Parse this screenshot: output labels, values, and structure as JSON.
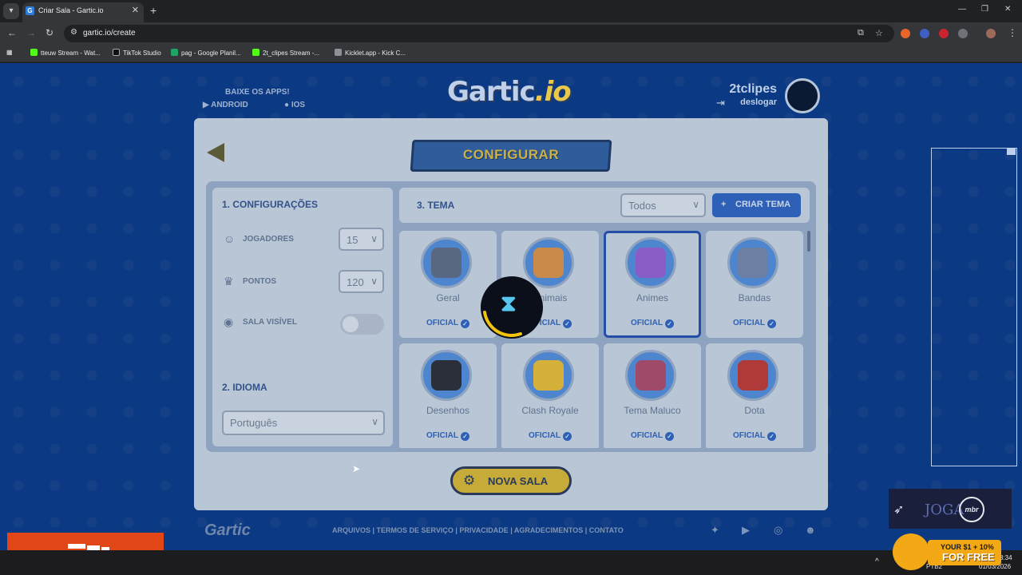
{
  "browser": {
    "tab_title": "Criar Sala - Gartic.io",
    "url": "gartic.io/create",
    "bookmarks": [
      {
        "label": "tteuw Stream - Wat...",
        "color": "#53fc18"
      },
      {
        "label": "TikTok Studio",
        "color": "#000000"
      },
      {
        "label": "pag - Google Planil...",
        "color": "#1fa463"
      },
      {
        "label": "2t_clipes Stream -...",
        "color": "#53fc18"
      },
      {
        "label": "Kicklet.app - Kick C...",
        "color": "#8e9097"
      }
    ]
  },
  "header": {
    "apps_title": "BAIXE OS APPS!",
    "android": "ANDROID",
    "ios": "IOS",
    "logo_main": "Gartic",
    "logo_suffix": ".io",
    "username": "2tclipes",
    "logout": "deslogar"
  },
  "config": {
    "banner": "CONFIGURAR",
    "settings_title": "1. CONFIGURAÇÕES",
    "players_label": "JOGADORES",
    "players_value": "15",
    "points_label": "PONTOS",
    "points_value": "120",
    "visible_label": "SALA VISÍVEL",
    "language_title": "2. IDIOMA",
    "language_value": "Português",
    "theme_title": "3. TEMA",
    "filter_value": "Todos",
    "create_theme": "CRIAR TEMA",
    "official_badge": "OFICIAL",
    "new_room": "NOVA SALA"
  },
  "themes": [
    {
      "label": "Geral",
      "icon": "slot-machine-icon",
      "selected": false,
      "color": "#5a6780"
    },
    {
      "label": "Animais",
      "icon": "dog-icon",
      "selected": false,
      "color": "#c98a4c"
    },
    {
      "label": "Animes",
      "icon": "anime-character-icon",
      "selected": true,
      "color": "#8a5cc7"
    },
    {
      "label": "Bandas",
      "icon": "microphone-icon",
      "selected": false,
      "color": "#6d7fa3"
    },
    {
      "label": "Desenhos",
      "icon": "mouse-cartoon-icon",
      "selected": false,
      "color": "#2b2f3a"
    },
    {
      "label": "Clash Royale",
      "icon": "crown-icon",
      "selected": false,
      "color": "#d5b13c"
    },
    {
      "label": "Tema Maluco",
      "icon": "clown-hat-icon",
      "selected": false,
      "color": "#a04a6a"
    },
    {
      "label": "Dota",
      "icon": "dota-logo-icon",
      "selected": false,
      "color": "#b03a3a"
    }
  ],
  "footer": {
    "logo": "Gartic",
    "links": "ARQUIVOS  |  TERMOS DE SERVIÇO  |  PRIVACIDADE  |  AGRADECIMENTOS  |  CONTATO"
  },
  "overlay": {
    "sponsor_text": "JOGA",
    "sponsor_badge": "mbr",
    "promo_line1": "YOUR $1 + 10%",
    "promo_line2": "FOR FREE"
  },
  "taskbar": {
    "lang": "PTB2",
    "time": "3:34",
    "date": "01/03/2026"
  },
  "colors": {
    "page_bg": "#0f4aa8",
    "accent_blue": "#2d60b6",
    "button_gold": "#c6ab38"
  }
}
